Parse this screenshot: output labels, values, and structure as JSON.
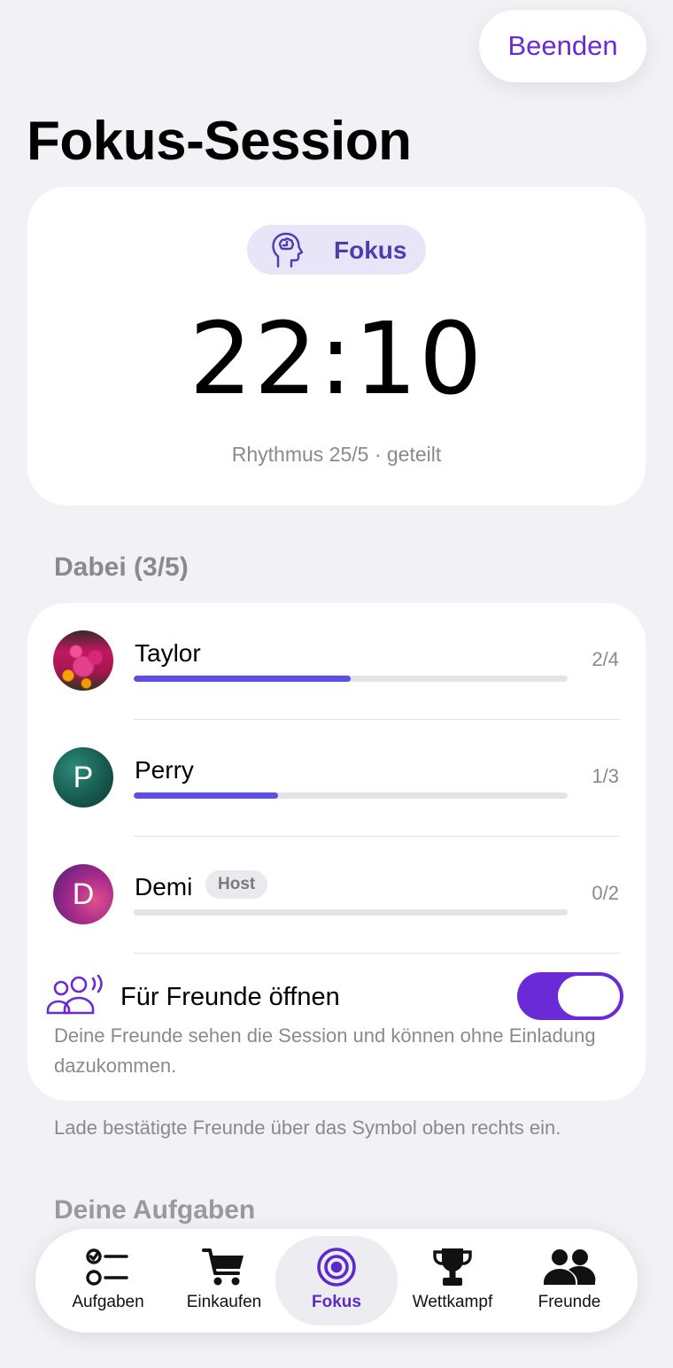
{
  "header": {
    "end_label": "Beenden",
    "title": "Fokus-Session"
  },
  "timer": {
    "mode_label": "Fokus",
    "time": "22:10",
    "rhythm": "Rhythmus 25/5 · geteilt"
  },
  "participants": {
    "heading": "Dabei (3/5)",
    "people": [
      {
        "name": "Taylor",
        "initial": "",
        "progress_text": "2/4",
        "progress": 0.5,
        "avatar_icon": "flower-photo"
      },
      {
        "name": "Perry",
        "initial": "P",
        "progress_text": "1/3",
        "progress": 0.333,
        "badge": ""
      },
      {
        "name": "Demi",
        "initial": "D",
        "progress_text": "0/2",
        "progress": 0,
        "badge": "Host"
      }
    ],
    "open_to_friends": {
      "title": "Für Freunde öffnen",
      "description": "Deine Freunde sehen die Session und können ohne Einladung dazukommen.",
      "enabled": true
    }
  },
  "hint": "Lade bestätigte Freunde über das Symbol oben rechts ein.",
  "tasks_heading": "Deine Aufgaben",
  "tabs": [
    {
      "label": "Aufgaben",
      "icon": "checklist-icon"
    },
    {
      "label": "Einkaufen",
      "icon": "cart-icon"
    },
    {
      "label": "Fokus",
      "icon": "target-icon",
      "active": true
    },
    {
      "label": "Wettkampf",
      "icon": "trophy-icon"
    },
    {
      "label": "Freunde",
      "icon": "people-icon"
    }
  ],
  "colors": {
    "accent": "#6A2BD6",
    "progress": "#5D4EE6",
    "background": "#F2F1F6"
  }
}
